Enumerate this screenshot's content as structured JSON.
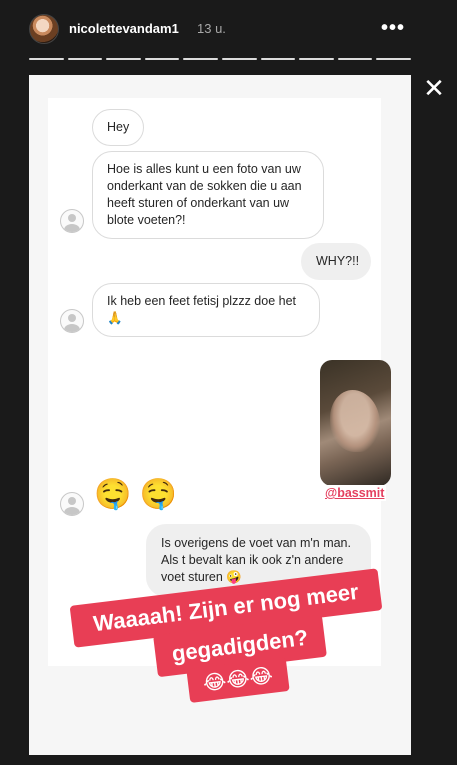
{
  "header": {
    "username": "nicolettevandam1",
    "time": "13 u.",
    "more": "•••",
    "close": "✕"
  },
  "progress_segments": 10,
  "chat": {
    "messages": [
      {
        "side": "left",
        "text": "Hey"
      },
      {
        "side": "left",
        "text": "Hoe is alles kunt u een foto van uw onderkant van de sokken die u aan heeft sturen of onderkant van uw blote voeten?!"
      },
      {
        "side": "right",
        "text": "WHY?!!"
      },
      {
        "side": "left",
        "text": "Ik heb een feet fetisj plzzz doe het 🙏"
      },
      {
        "side": "left",
        "text": "🤤 🤤"
      },
      {
        "side": "right",
        "text": "Is overigens de voet van m'n man. Als t bevalt kan ik ook z'n andere voet sturen 🤪"
      }
    ],
    "mention": "@bassmit"
  },
  "stickers": {
    "line1": "Waaaah! Zijn er nog meer",
    "line2": "gegadigden?",
    "line3": "😂😂😂"
  }
}
